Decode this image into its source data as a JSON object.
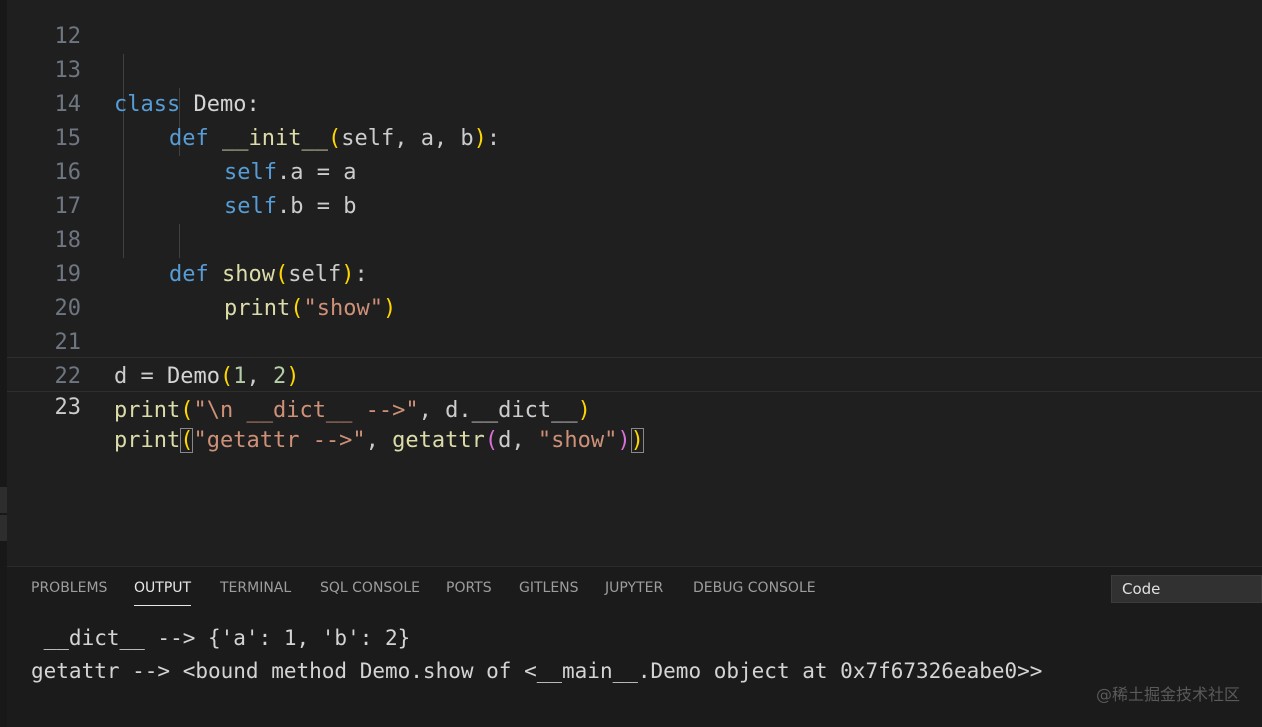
{
  "editor": {
    "lines": [
      {
        "number": "12"
      },
      {
        "number": "13"
      },
      {
        "number": "14"
      },
      {
        "number": "15"
      },
      {
        "number": "16"
      },
      {
        "number": "17"
      },
      {
        "number": "18"
      },
      {
        "number": "19"
      },
      {
        "number": "20"
      },
      {
        "number": "21"
      },
      {
        "number": "22"
      },
      {
        "number": "23"
      }
    ],
    "code": {
      "l13_kw": "class",
      "l13_name": " Demo:",
      "l14_kw": "def",
      "l14_fn": "__init__",
      "l14_p_open": "(",
      "l14_args": "self, a, b",
      "l14_p_close": ")",
      "l14_colon": ":",
      "l15_self": "self",
      "l15_rest": ".a = a",
      "l16_self": "self",
      "l16_rest": ".b = b",
      "l18_kw": "def",
      "l18_fn": "show",
      "l18_p_open": "(",
      "l18_args": "self",
      "l18_p_close": ")",
      "l18_colon": ":",
      "l19_fn": "print",
      "l19_p_open": "(",
      "l19_str": "\"show\"",
      "l19_p_close": ")",
      "l21_var": "d = ",
      "l21_cls": "Demo",
      "l21_p_open": "(",
      "l21_n1": "1",
      "l21_sep": ", ",
      "l21_n2": "2",
      "l21_p_close": ")",
      "l22_fn": "print",
      "l22_p_open": "(",
      "l22_str": "\"\\n __dict__ -->\"",
      "l22_rest": ", d.__dict__",
      "l22_p_close": ")",
      "l23_fn": "print",
      "l23_p_open": "(",
      "l23_str": "\"getattr -->\"",
      "l23_sep": ", ",
      "l23_fn2": "getattr",
      "l23_p2_open": "(",
      "l23_arg": "d, ",
      "l23_str2": "\"show\"",
      "l23_p2_close": ")",
      "l23_p_close": ")"
    }
  },
  "panel": {
    "tabs": [
      {
        "label": "PROBLEMS"
      },
      {
        "label": "OUTPUT"
      },
      {
        "label": "TERMINAL"
      },
      {
        "label": "SQL CONSOLE"
      },
      {
        "label": "PORTS"
      },
      {
        "label": "GITLENS"
      },
      {
        "label": "JUPYTER"
      },
      {
        "label": "DEBUG CONSOLE"
      }
    ],
    "active_tab": "OUTPUT",
    "output_channel": "Code",
    "output_lines": [
      " __dict__ --> {'a': 1, 'b': 2}",
      "getattr --> <bound method Demo.show of <__main__.Demo object at 0x7f67326eabe0>>"
    ]
  },
  "watermark": "@稀土掘金技术社区",
  "colors": {
    "keyword": "#569cd6",
    "function": "#dcdcaa",
    "string": "#ce9178",
    "number": "#b5cea8",
    "bracket_level1": "#ffd700",
    "bracket_level2": "#da70d6"
  }
}
